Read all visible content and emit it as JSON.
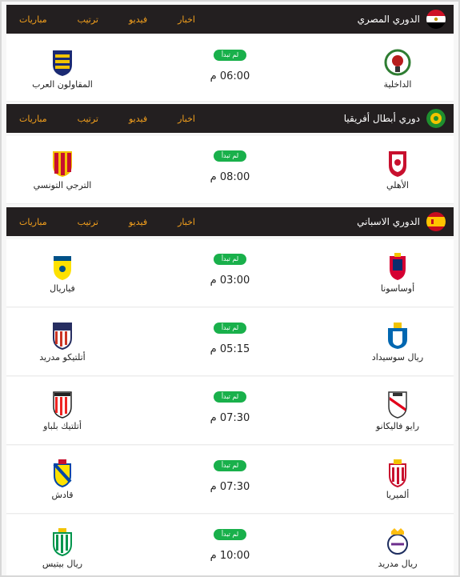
{
  "status_label": "لم تبدأ",
  "leagues": [
    {
      "name": "الدوري المصري",
      "flag": "egypt-flag-icon",
      "links": [
        "مباريات",
        "ترتيب",
        "فيديو",
        "اخبار"
      ],
      "matches": [
        {
          "home": "الداخلية",
          "away": "المقاولون العرب",
          "time": "06:00 م"
        }
      ]
    },
    {
      "name": "دوري أبطال أفريقيا",
      "flag": "caf-logo-icon",
      "links": [
        "مباريات",
        "ترتيب",
        "فيديو",
        "اخبار"
      ],
      "matches": [
        {
          "home": "الأهلي",
          "away": "الترجي التونسي",
          "time": "08:00 م"
        }
      ]
    },
    {
      "name": "الدوري الاسباني",
      "flag": "spain-flag-icon",
      "links": [
        "مباريات",
        "ترتيب",
        "فيديو",
        "اخبار"
      ],
      "matches": [
        {
          "home": "أوساسونا",
          "away": "فياريال",
          "time": "03:00 م"
        },
        {
          "home": "ريال سوسيداد",
          "away": "أتلتيكو مدريد",
          "time": "05:15 م"
        },
        {
          "home": "رايو فاليكانو",
          "away": "أتلتيك بلباو",
          "time": "07:30 م"
        },
        {
          "home": "ألميريا",
          "away": "قادش",
          "time": "07:30 م"
        },
        {
          "home": "ريال مدريد",
          "away": "ريال بيتيس",
          "time": "10:00 م"
        }
      ]
    }
  ],
  "colors": {
    "accent": "#f4a01c",
    "header_bg": "#231f20",
    "status": "#19b04b"
  }
}
